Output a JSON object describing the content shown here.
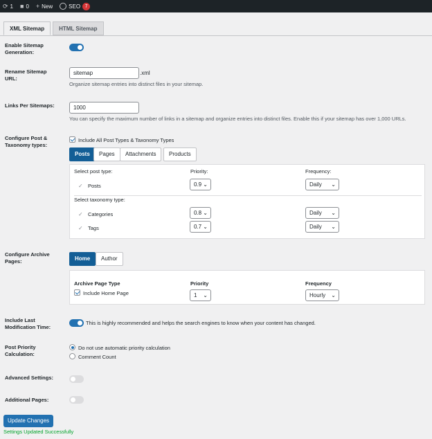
{
  "adminbar": {
    "updates_count": "1",
    "comments_count": "0",
    "new_label": "New",
    "seo_label": "SEO",
    "seo_badge": "7"
  },
  "tabs": [
    {
      "label": "XML Sitemap",
      "active": true
    },
    {
      "label": "HTML Sitemap",
      "active": false
    }
  ],
  "enable": {
    "label": "Enable Sitemap Generation:",
    "on": true
  },
  "rename": {
    "label": "Rename Sitemap URL:",
    "value": "sitemap",
    "suffix": ".xml",
    "help": "Organize sitemap entries into distinct files in your sitemap."
  },
  "links": {
    "label": "Links Per Sitemaps:",
    "value": "1000",
    "help": "You can specify the maximum number of links in a sitemap and organize entries into distinct files. Enable this if your sitemap has over 1,000 URLs."
  },
  "post_types": {
    "label": "Configure Post & Taxonomy types:",
    "include_all": "Include All Post Types & Taxonomy Types",
    "tabs": [
      "Posts",
      "Pages",
      "Attachments",
      "Products"
    ],
    "headers": {
      "type": "Select post type:",
      "priority": "Priority:",
      "frequency": "Frequency:"
    },
    "posts": [
      {
        "name": "Posts",
        "priority": "0.9",
        "frequency": "Daily"
      }
    ],
    "taxonomy_header": "Select taxonomy type:",
    "taxonomies": [
      {
        "name": "Categories",
        "priority": "0.8",
        "frequency": "Daily"
      },
      {
        "name": "Tags",
        "priority": "0.7",
        "frequency": "Daily"
      }
    ]
  },
  "archive": {
    "label": "Configure Archive Pages:",
    "tabs": [
      "Home",
      "Author"
    ],
    "headers": {
      "type": "Archive Page Type",
      "priority": "Priority",
      "frequency": "Frequency"
    },
    "row": {
      "name": "Include Home Page",
      "priority": "1",
      "frequency": "Hourly"
    }
  },
  "lastmod": {
    "label": "Include Last Modification Time:",
    "on": true,
    "help": "This is highly recommended and helps the search engines to know when your content has changed."
  },
  "priority_calc": {
    "label": "Post Priority Calculation:",
    "options": [
      "Do not use automatic priority calculation",
      "Comment Count"
    ],
    "selected": 0
  },
  "advanced": {
    "label": "Advanced Settings:",
    "on": false
  },
  "additional": {
    "label": "Additional Pages:",
    "on": false
  },
  "actions": {
    "update_label": "Update Changes",
    "success": "Settings Updated Successfully"
  },
  "icons": {
    "wp": "wordpress-icon",
    "updates": "refresh-icon",
    "comment": "comment-icon",
    "plus": "plus-icon",
    "seo": "seo-icon"
  }
}
